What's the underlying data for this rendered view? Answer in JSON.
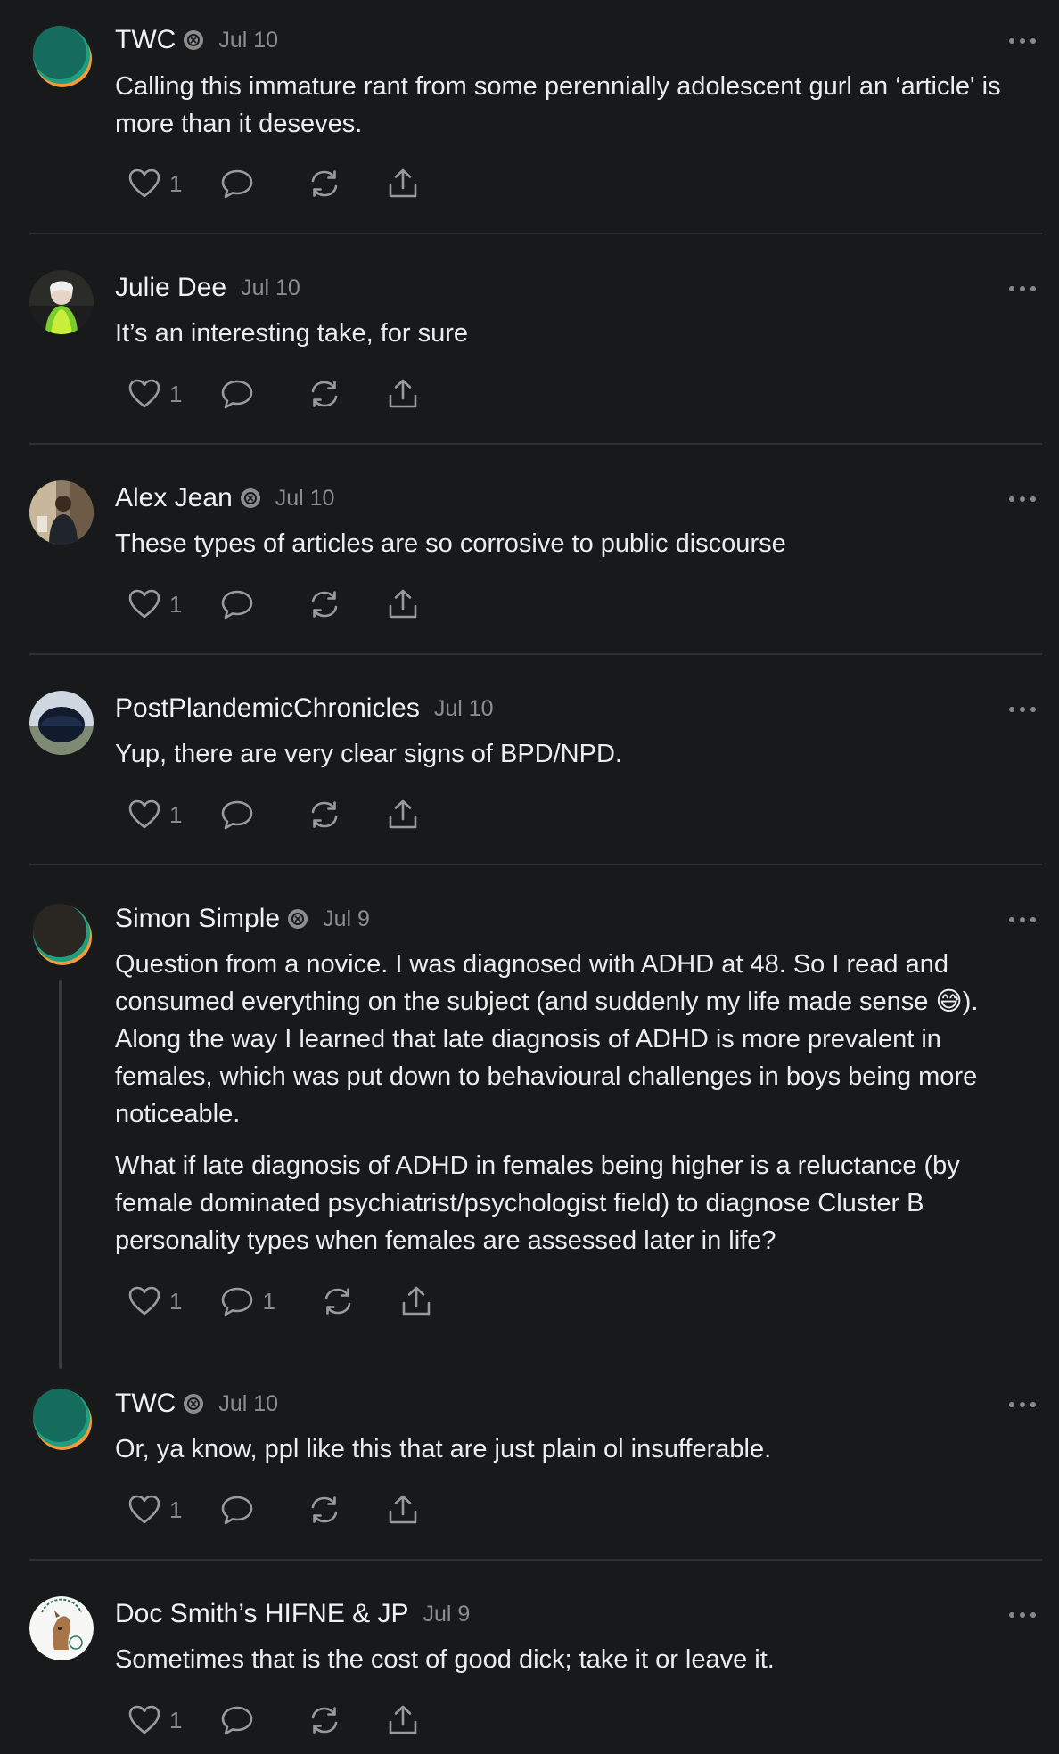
{
  "comments": [
    {
      "author": "TWC",
      "badge": true,
      "date": "Jul 10",
      "text": [
        "Calling this immature rant from some perennially adolescent gurl an ‘article' is more than it deseves."
      ],
      "likes": "1",
      "replies": "",
      "avatar": "teal-orange-circle"
    },
    {
      "author": "Julie Dee",
      "badge": false,
      "date": "Jul 10",
      "text": [
        "It’s an interesting take, for sure"
      ],
      "likes": "1",
      "replies": "",
      "avatar": "photo-woman-green-scarf"
    },
    {
      "author": "Alex Jean",
      "badge": true,
      "date": "Jul 10",
      "text": [
        "These types of articles are so corrosive to public discourse"
      ],
      "likes": "1",
      "replies": "",
      "avatar": "photo-man-indoors"
    },
    {
      "author": "PostPlandemicChronicles",
      "badge": false,
      "date": "Jul 10",
      "text": [
        "Yup, there are very clear signs of BPD/NPD."
      ],
      "likes": "1",
      "replies": "",
      "avatar": "photo-dark-helmet"
    },
    {
      "author": "Simon Simple",
      "badge": true,
      "date": "Jul 9",
      "text": [
        "Question from a novice. I was diagnosed with ADHD at 48. So I read and consumed everything on the subject (and suddenly my life made sense 😅). Along the way I learned that late diagnosis of ADHD is more prevalent in females, which was put down to behavioural challenges in boys being more noticeable.",
        "What if late diagnosis of ADHD in females being higher is a reluctance (by female dominated psychiatrist/psychologist field) to diagnose Cluster B personality types when females are assessed later in life?"
      ],
      "likes": "1",
      "replies": "1",
      "avatar": "dark-orange-teal-circle"
    },
    {
      "author": "TWC",
      "badge": true,
      "date": "Jul 10",
      "text": [
        "Or, ya know, ppl like this that are just plain ol insufferable."
      ],
      "likes": "1",
      "replies": "",
      "avatar": "teal-orange-circle"
    },
    {
      "author": "Doc Smith’s HIFNE & JP",
      "badge": false,
      "date": "Jul 9",
      "text": [
        "Sometimes that is the cost of good dick; take it or leave it."
      ],
      "likes": "1",
      "replies": "",
      "avatar": "illustration-horse-logo"
    }
  ],
  "colors": {
    "background": "#18191b",
    "text": "#ececec",
    "muted": "#8d8d8d",
    "divider": "#2e2f31",
    "teal": "#167a68",
    "orange": "#f39a3a"
  }
}
